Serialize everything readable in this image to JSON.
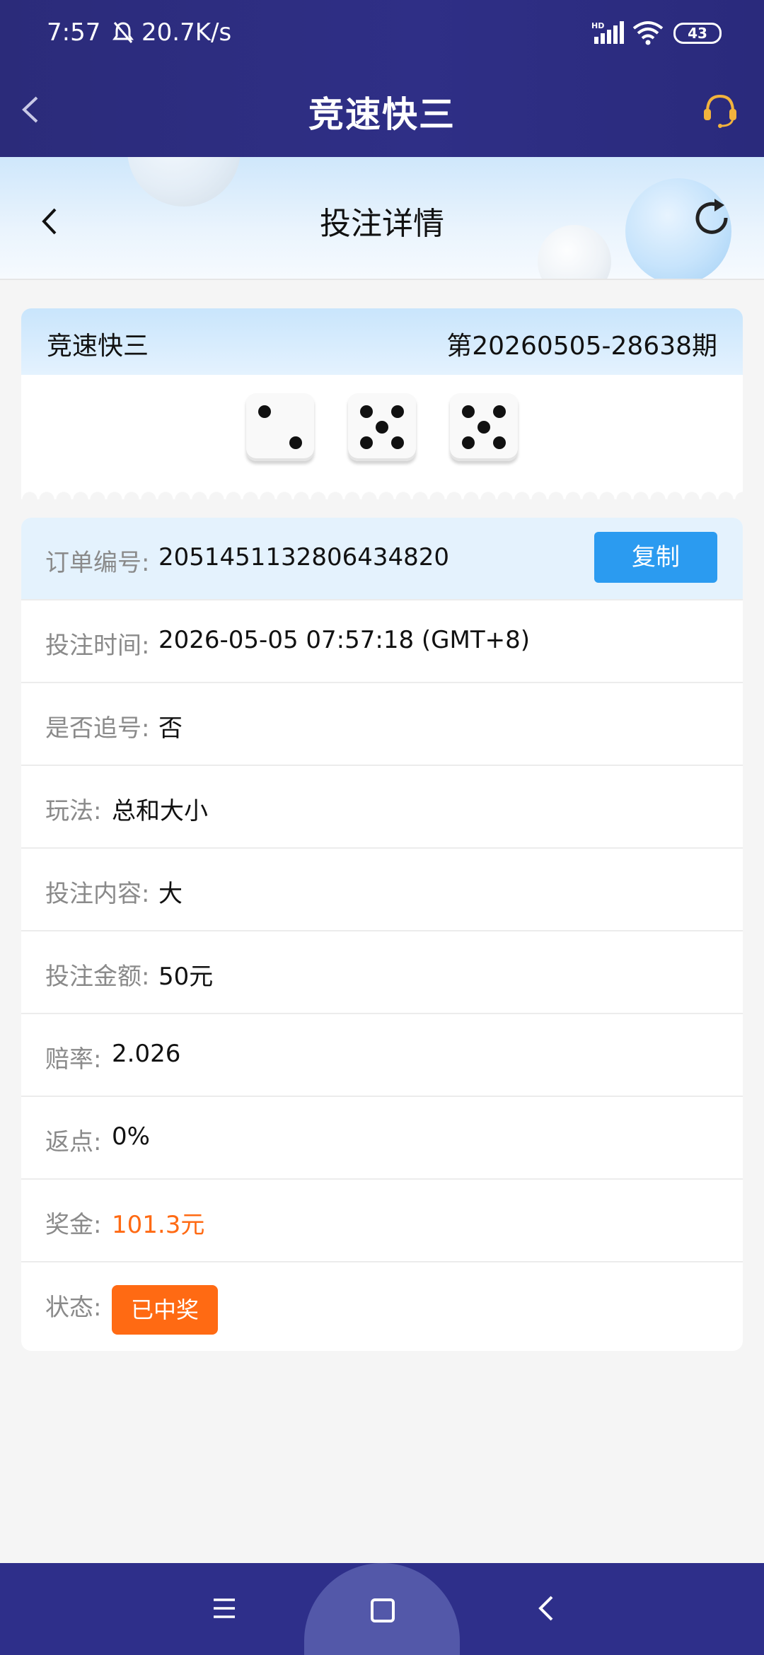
{
  "status_bar": {
    "time": "7:57",
    "net_speed": "20.7K/s",
    "battery": "43",
    "icons": [
      "bell-muted-icon",
      "signal-hd-icon",
      "wifi-icon",
      "battery-icon"
    ]
  },
  "app_header": {
    "title": "竞速快三",
    "back_icon": "chevron-left-icon",
    "service_icon": "headset-icon"
  },
  "sub_header": {
    "title": "投注详情",
    "back_icon": "chevron-left-icon",
    "refresh_icon": "refresh-icon"
  },
  "result": {
    "game_name": "竞速快三",
    "period": "第20260505-28638期",
    "dice": [
      2,
      5,
      5
    ]
  },
  "order": {
    "rows": [
      {
        "label": "订单编号:",
        "value": "2051451132806434820"
      },
      {
        "label": "投注时间:",
        "value": "2026-05-05 07:57:18 (GMT+8)"
      },
      {
        "label": "是否追号:",
        "value": "否"
      },
      {
        "label": "玩法:",
        "value": "总和大小"
      },
      {
        "label": "投注内容:",
        "value": "大"
      },
      {
        "label": "投注金额:",
        "value": "50元"
      },
      {
        "label": "赔率:",
        "value": "2.026"
      },
      {
        "label": "返点:",
        "value": "0%"
      },
      {
        "label": "奖金:",
        "value": "101.3元"
      },
      {
        "label": "状态:",
        "value": "已中奖"
      }
    ],
    "copy_label": "复制"
  },
  "colors": {
    "header_bg": "#2e2f86",
    "accent_blue": "#2b9bf0",
    "accent_orange": "#ff6a13"
  },
  "nav_bar": {
    "icons": [
      "menu-icon",
      "home-icon",
      "back-icon"
    ]
  }
}
